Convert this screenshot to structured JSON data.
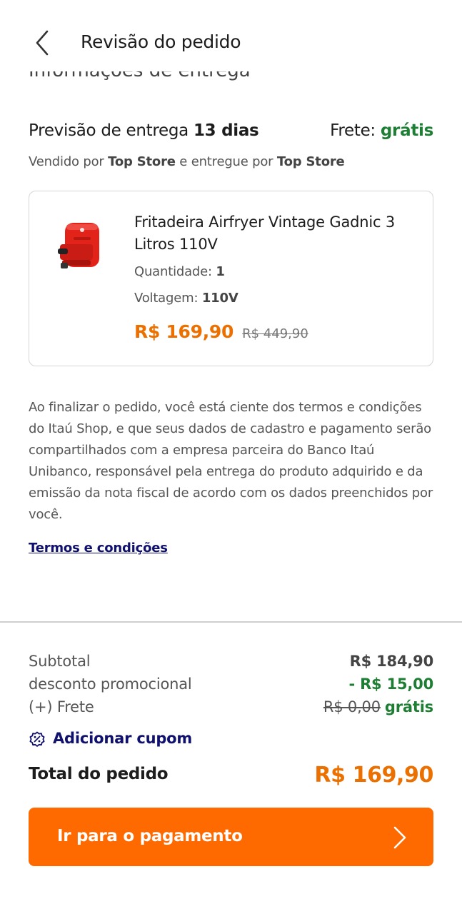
{
  "header": {
    "title": "Revisão do pedido",
    "back_icon": "chevron-left-icon",
    "scrolled_fragment": "Informações de entrega"
  },
  "delivery": {
    "prefix": "Previsão de entrega ",
    "days": "13 dias",
    "freight_label": "Frete: ",
    "freight_value": "grátis",
    "seller_line": {
      "sold_by": "Vendido por ",
      "seller": "Top Store",
      "delivered_by": " e entregue por ",
      "deliverer": "Top Store"
    }
  },
  "product": {
    "image_icon": "airfryer-product-image",
    "name": "Fritadeira Airfryer Vintage Gadnic 3 Litros 110V",
    "quantity_label": "Quantidade: ",
    "quantity_value": "1",
    "voltage_label": "Voltagem: ",
    "voltage_value": "110V",
    "price_now": "R$ 169,90",
    "price_old": "R$ 449,90"
  },
  "legal": {
    "text": "Ao finalizar o pedido, você está ciente dos termos e condições do Itaú Shop, e que seus dados de cadastro e pagamento serão compartilhados com a empresa parceira do Banco Itaú Unibanco, responsável pela entrega do produto adquirido e da emissão da nota fiscal de acordo com os dados preenchidos por você.",
    "terms_link": "Termos e condições"
  },
  "summary": {
    "subtotal_label": "Subtotal",
    "subtotal_value": "R$ 184,90",
    "discount_label": "desconto promocional",
    "discount_value": "- R$ 15,00",
    "freight_label": "(+) Frete",
    "freight_old": "R$ 0,00",
    "freight_value": "grátis",
    "coupon_icon": "coupon-percent-icon",
    "coupon_label": "Adicionar cupom",
    "total_label": "Total do pedido",
    "total_value": "R$ 169,90"
  },
  "cta": {
    "label": "Ir para o pagamento",
    "icon": "chevron-right-icon"
  },
  "colors": {
    "accent_orange": "#ec7000",
    "button_orange": "#ff6a00",
    "green": "#1e7e34",
    "link_navy": "#10106e"
  }
}
